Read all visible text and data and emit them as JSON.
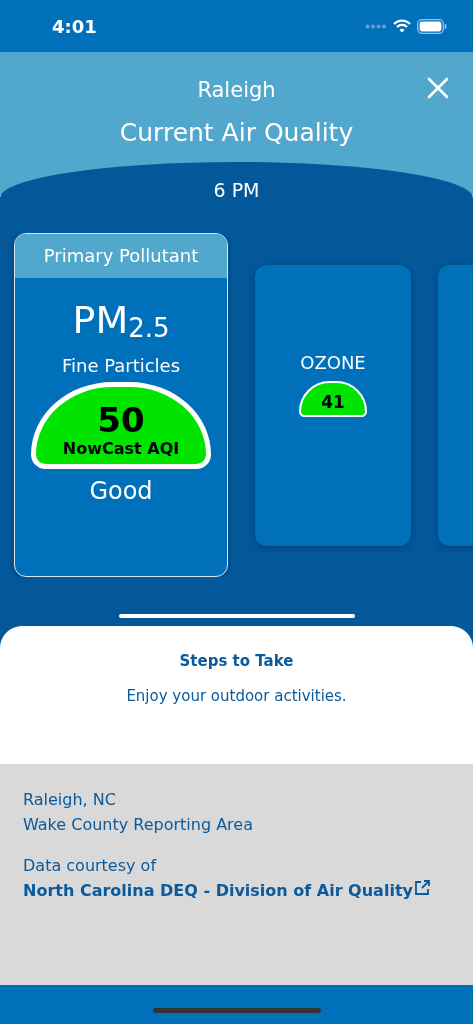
{
  "status_bar": {
    "time": "4:01"
  },
  "header": {
    "location": "Raleigh",
    "title": "Current Air Quality"
  },
  "time_label": "6 PM",
  "cards": [
    {
      "selected": true,
      "header": "Primary Pollutant",
      "name": "PM$_{2.5}$",
      "description": "Fine Particles",
      "aqi": "50",
      "aqi_label": "NowCast AQI",
      "category": "Good",
      "color": "#00e400"
    },
    {
      "selected": false,
      "name": "OZONE",
      "aqi": "41",
      "color": "#00e400"
    },
    {
      "selected": false
    }
  ],
  "steps": {
    "title": "Steps to Take",
    "text": "Enjoy your outdoor activities."
  },
  "info": {
    "location": "Raleigh, NC",
    "area": "Wake County Reporting Area",
    "credit": "Data courtesy of",
    "source_link": "North Carolina DEQ - Division of Air Quality"
  }
}
